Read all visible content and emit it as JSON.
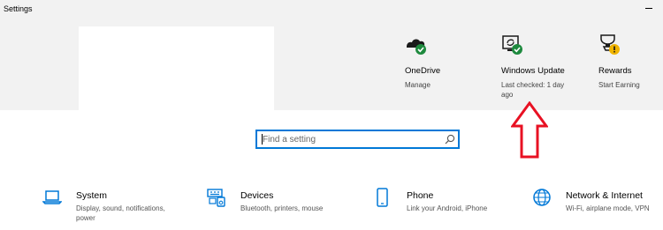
{
  "window": {
    "title": "Settings"
  },
  "quick_links": [
    {
      "title": "OneDrive",
      "subtitle": "Manage",
      "icon": "onedrive-icon"
    },
    {
      "title": "Windows Update",
      "subtitle": "Last checked: 1 day ago",
      "icon": "windows-update-icon"
    },
    {
      "title": "Rewards",
      "subtitle": "Start Earning",
      "icon": "rewards-icon"
    }
  ],
  "search": {
    "placeholder": "Find a setting",
    "value": ""
  },
  "categories": [
    {
      "title": "System",
      "description": "Display, sound, notifications, power",
      "icon": "laptop-icon"
    },
    {
      "title": "Devices",
      "description": "Bluetooth, printers, mouse",
      "icon": "keyboard-icon"
    },
    {
      "title": "Phone",
      "description": "Link your Android, iPhone",
      "icon": "phone-icon"
    },
    {
      "title": "Network & Internet",
      "description": "Wi-Fi, airplane mode, VPN",
      "icon": "globe-icon"
    }
  ],
  "colors": {
    "accent": "#0078d7",
    "status_ok": "#1e8a3e",
    "status_warning": "#f0b400",
    "annotation_arrow": "#e81123",
    "banner_background": "#f2f2f2"
  }
}
